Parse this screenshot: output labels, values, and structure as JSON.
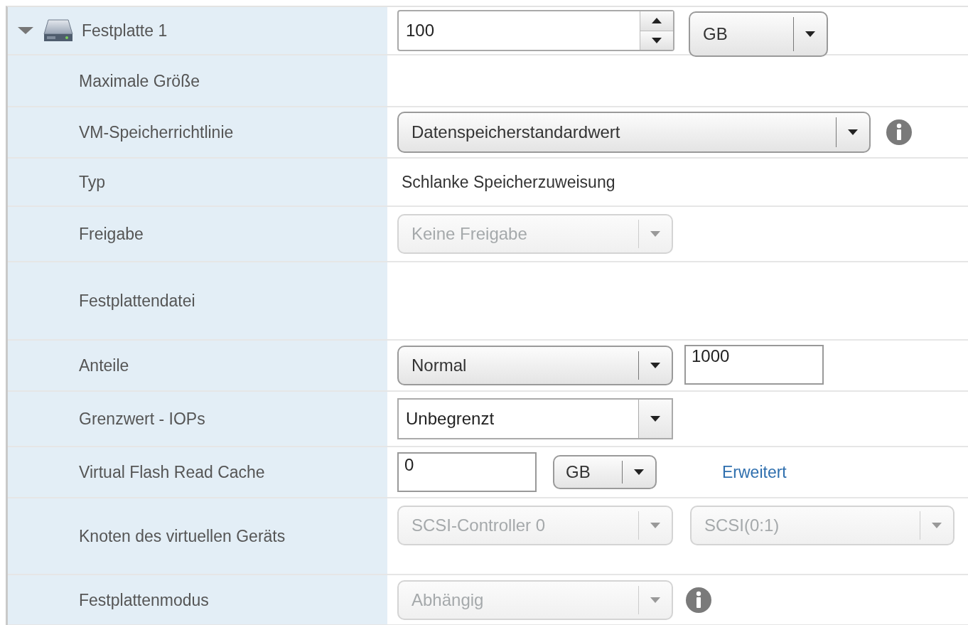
{
  "rows": [
    {
      "label": "Festplatte 1",
      "expanded": true,
      "controls": [
        {
          "kind": "spinner",
          "value": "100"
        },
        {
          "kind": "combo",
          "value": "GB",
          "disabled": false
        }
      ]
    },
    {
      "label": "Maximale Größe",
      "controls": []
    },
    {
      "label": "VM-Speicherrichtlinie",
      "controls": [
        {
          "kind": "combo",
          "value": "Datenspeicherstandardwert",
          "disabled": false
        },
        {
          "kind": "info"
        }
      ]
    },
    {
      "label": "Typ",
      "controls": [
        {
          "kind": "text",
          "value": "Schlanke Speicherzuweisung"
        }
      ]
    },
    {
      "label": "Freigabe",
      "controls": [
        {
          "kind": "combo",
          "value": "Keine Freigabe",
          "disabled": true
        }
      ]
    },
    {
      "label": "Festplattendatei",
      "controls": []
    },
    {
      "label": "Anteile",
      "controls": [
        {
          "kind": "combo",
          "value": "Normal",
          "disabled": false
        },
        {
          "kind": "input",
          "value": "1000"
        }
      ]
    },
    {
      "label": "Grenzwert - IOPs",
      "controls": [
        {
          "kind": "flatselect",
          "value": "Unbegrenzt"
        }
      ]
    },
    {
      "label": "Virtual Flash Read Cache",
      "controls": [
        {
          "kind": "input",
          "value": "0"
        },
        {
          "kind": "combo",
          "value": "GB",
          "disabled": false
        },
        {
          "kind": "link",
          "value": "Erweitert"
        }
      ]
    },
    {
      "label": "Knoten des virtuellen Geräts",
      "controls": [
        {
          "kind": "combo",
          "value": "SCSI-Controller 0",
          "disabled": true
        },
        {
          "kind": "combo",
          "value": "SCSI(0:1)",
          "disabled": true
        }
      ]
    },
    {
      "label": "Festplattenmodus",
      "controls": [
        {
          "kind": "combo",
          "value": "Abhängig",
          "disabled": true
        },
        {
          "kind": "info"
        }
      ]
    }
  ]
}
